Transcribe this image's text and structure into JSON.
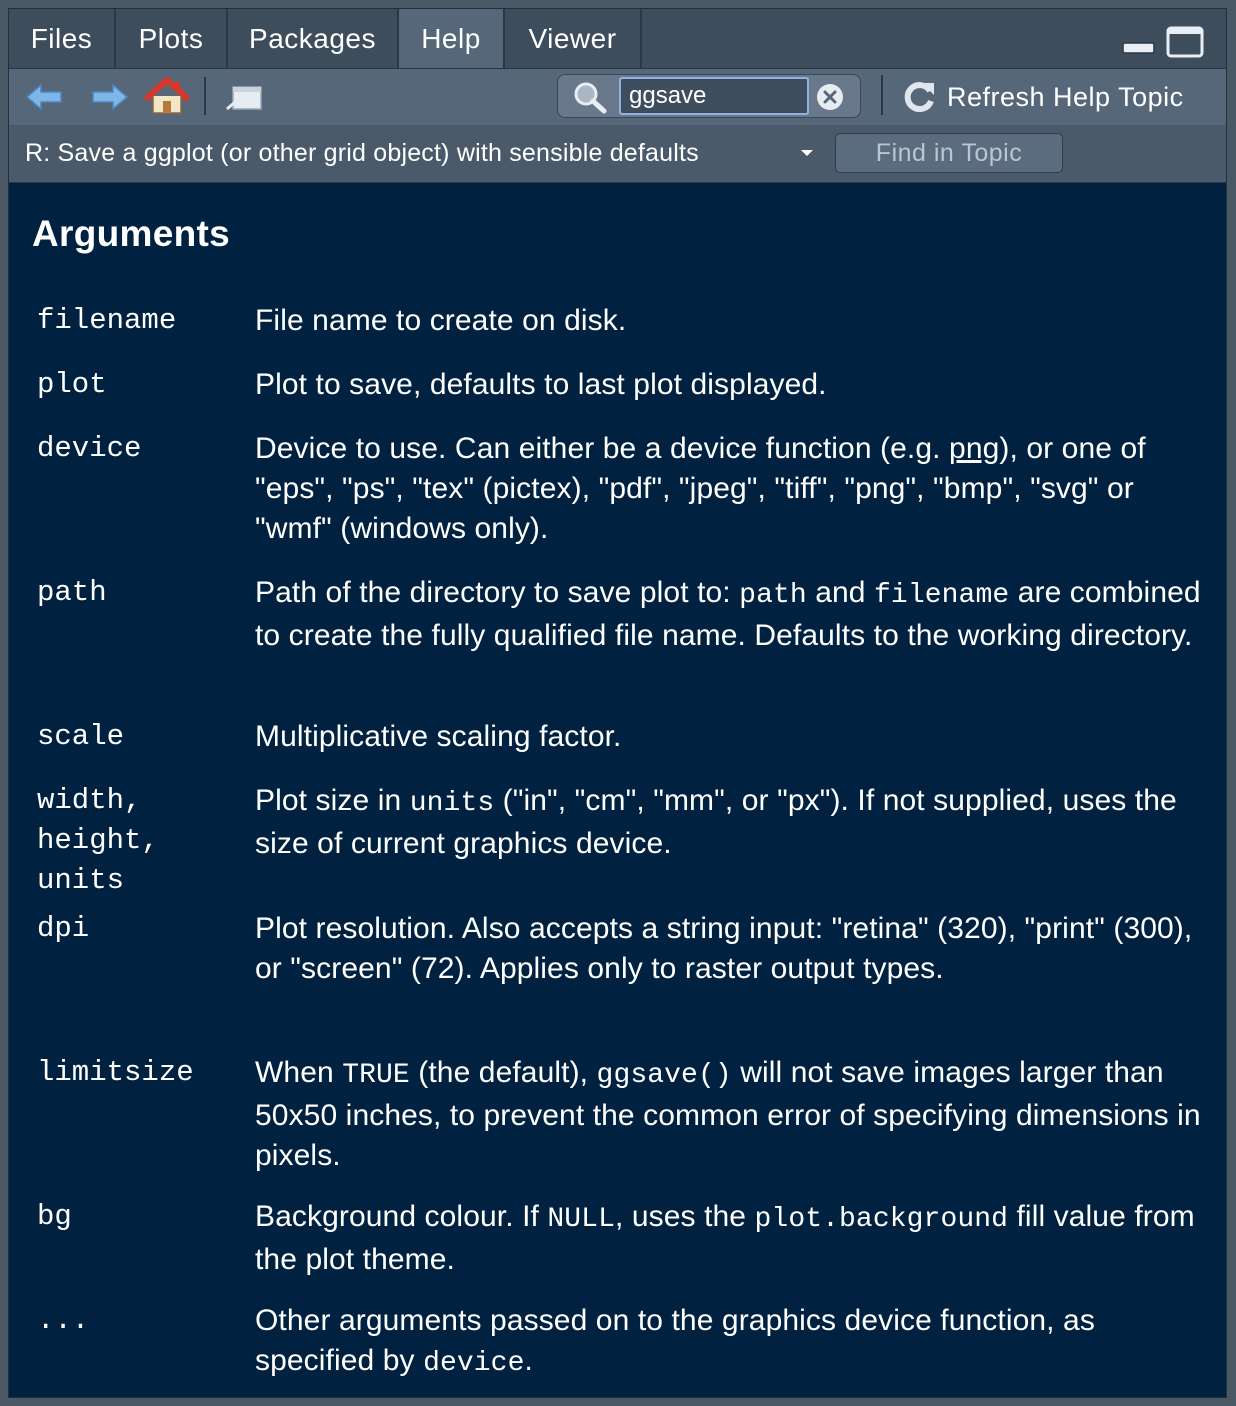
{
  "tabs": [
    {
      "label": "Files",
      "active": false
    },
    {
      "label": "Plots",
      "active": false
    },
    {
      "label": "Packages",
      "active": false
    },
    {
      "label": "Help",
      "active": true
    },
    {
      "label": "Viewer",
      "active": false
    }
  ],
  "toolbar": {
    "search_value": "ggsave",
    "refresh_label": "Refresh Help Topic"
  },
  "topic": {
    "title": "R: Save a ggplot (or other grid object) with sensible defaults",
    "find_label": "Find in Topic"
  },
  "content": {
    "heading": "Arguments",
    "args": [
      {
        "name": "filename",
        "desc": "File name to create on disk."
      },
      {
        "name": "plot",
        "desc": "Plot to save, defaults to last plot displayed."
      },
      {
        "name": "device",
        "desc_a": "Device to use. Can either be a device function (e.g. ",
        "link": "png",
        "desc_b": "), or one of \"eps\", \"ps\", \"tex\" (pictex), \"pdf\", \"jpeg\", \"tiff\", \"png\", \"bmp\", \"svg\" or \"wmf\" (windows only)."
      },
      {
        "name": "path",
        "desc_a": "Path of the directory to save plot to: ",
        "code1": "path",
        "desc_b": " and ",
        "code2": "filename",
        "desc_c": " are combined to create the fully qualified file name. Defaults to the working directory."
      },
      {
        "name": "scale",
        "desc": "Multiplicative scaling factor."
      },
      {
        "name": "width, height, units",
        "desc_a": "Plot size in ",
        "code1": "units",
        "desc_b": " (\"in\", \"cm\", \"mm\", or \"px\"). If not supplied, uses the size of current graphics device."
      },
      {
        "name": "dpi",
        "desc": "Plot resolution. Also accepts a string input: \"retina\" (320), \"print\" (300), or \"screen\" (72). Applies only to raster output types."
      },
      {
        "name": "limitsize",
        "desc_a": "When ",
        "code1": "TRUE",
        "desc_b": " (the default), ",
        "code2": "ggsave()",
        "desc_c": " will not save images larger than 50x50 inches, to prevent the common error of specifying dimensions in pixels."
      },
      {
        "name": "bg",
        "desc_a": "Background colour. If ",
        "code1": "NULL",
        "desc_b": ", uses the ",
        "code2": "plot.background",
        "desc_c": " fill value from the plot theme."
      },
      {
        "name": "...",
        "desc_a": "Other arguments passed on to the graphics device function, as specified by ",
        "code1": "device",
        "desc_b": "."
      }
    ]
  },
  "colors": {
    "content_bg": "#002240",
    "toolbar_bg": "#56677a",
    "tab_active_bg": "#56677a",
    "search_focus_border": "#8fb3e0",
    "home_roof": "#d9372b"
  }
}
